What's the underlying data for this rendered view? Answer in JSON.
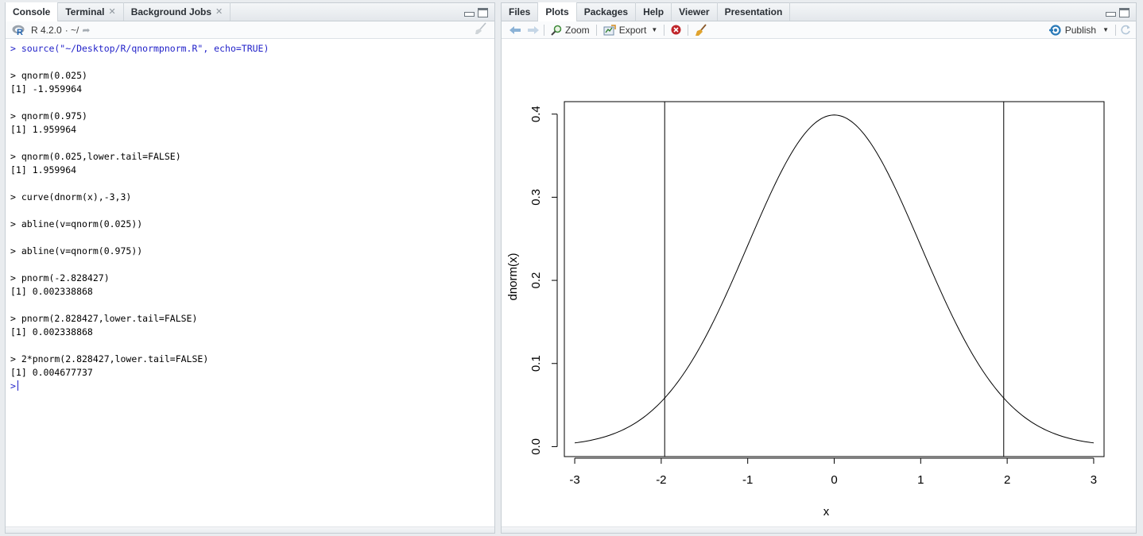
{
  "left": {
    "tabs": [
      {
        "label": "Console",
        "active": true,
        "closable": false
      },
      {
        "label": "Terminal",
        "active": false,
        "closable": true
      },
      {
        "label": "Background Jobs",
        "active": false,
        "closable": true
      }
    ],
    "r_version": "R 4.2.0",
    "working_dir": "· ~/",
    "console_lines": [
      {
        "text": "> source(\"~/Desktop/R/qnormpnorm.R\", echo=TRUE)",
        "blue": true
      },
      {
        "text": "",
        "blue": false
      },
      {
        "text": "> qnorm(0.025)",
        "blue": false
      },
      {
        "text": "[1] -1.959964",
        "blue": false
      },
      {
        "text": "",
        "blue": false
      },
      {
        "text": "> qnorm(0.975)",
        "blue": false
      },
      {
        "text": "[1] 1.959964",
        "blue": false
      },
      {
        "text": "",
        "blue": false
      },
      {
        "text": "> qnorm(0.025,lower.tail=FALSE)",
        "blue": false
      },
      {
        "text": "[1] 1.959964",
        "blue": false
      },
      {
        "text": "",
        "blue": false
      },
      {
        "text": "> curve(dnorm(x),-3,3)",
        "blue": false
      },
      {
        "text": "",
        "blue": false
      },
      {
        "text": "> abline(v=qnorm(0.025))",
        "blue": false
      },
      {
        "text": "",
        "blue": false
      },
      {
        "text": "> abline(v=qnorm(0.975))",
        "blue": false
      },
      {
        "text": "",
        "blue": false
      },
      {
        "text": "> pnorm(-2.828427)",
        "blue": false
      },
      {
        "text": "[1] 0.002338868",
        "blue": false
      },
      {
        "text": "",
        "blue": false
      },
      {
        "text": "> pnorm(2.828427,lower.tail=FALSE)",
        "blue": false
      },
      {
        "text": "[1] 0.002338868",
        "blue": false
      },
      {
        "text": "",
        "blue": false
      },
      {
        "text": "> 2*pnorm(2.828427,lower.tail=FALSE)",
        "blue": false
      },
      {
        "text": "[1] 0.004677737",
        "blue": false
      }
    ],
    "prompt": ">"
  },
  "right": {
    "tabs": [
      {
        "label": "Files",
        "active": false
      },
      {
        "label": "Plots",
        "active": true
      },
      {
        "label": "Packages",
        "active": false
      },
      {
        "label": "Help",
        "active": false
      },
      {
        "label": "Viewer",
        "active": false
      },
      {
        "label": "Presentation",
        "active": false
      }
    ],
    "toolbar": {
      "zoom_label": "Zoom",
      "export_label": "Export",
      "publish_label": "Publish"
    }
  },
  "colors": {
    "console_command_blue": "#1f1fc8",
    "publish_blue": "#2a7ab8",
    "remove_red": "#c0262b"
  },
  "chart_data": {
    "type": "line",
    "function": "dnorm(x)",
    "x": [
      -3,
      -2.75,
      -2.5,
      -2.25,
      -2,
      -1.75,
      -1.5,
      -1.25,
      -1,
      -0.75,
      -0.5,
      -0.25,
      0,
      0.25,
      0.5,
      0.75,
      1,
      1.25,
      1.5,
      1.75,
      2,
      2.25,
      2.5,
      2.75,
      3
    ],
    "y": [
      0.0044,
      0.0091,
      0.0175,
      0.0317,
      0.054,
      0.0863,
      0.1295,
      0.1826,
      0.242,
      0.3011,
      0.3521,
      0.3867,
      0.3989,
      0.3867,
      0.3521,
      0.3011,
      0.242,
      0.1826,
      0.1295,
      0.0863,
      0.054,
      0.0317,
      0.0175,
      0.0091,
      0.0044
    ],
    "vlines": [
      -1.959964,
      1.959964
    ],
    "xlabel": "x",
    "ylabel": "dnorm(x)",
    "xticks": [
      "-3",
      "-2",
      "-1",
      "0",
      "1",
      "2",
      "3"
    ],
    "yticks": [
      "0.0",
      "0.1",
      "0.2",
      "0.3",
      "0.4"
    ],
    "xlim": [
      -3.12,
      3.12
    ],
    "ylim": [
      -0.012,
      0.415
    ],
    "grid": false
  }
}
